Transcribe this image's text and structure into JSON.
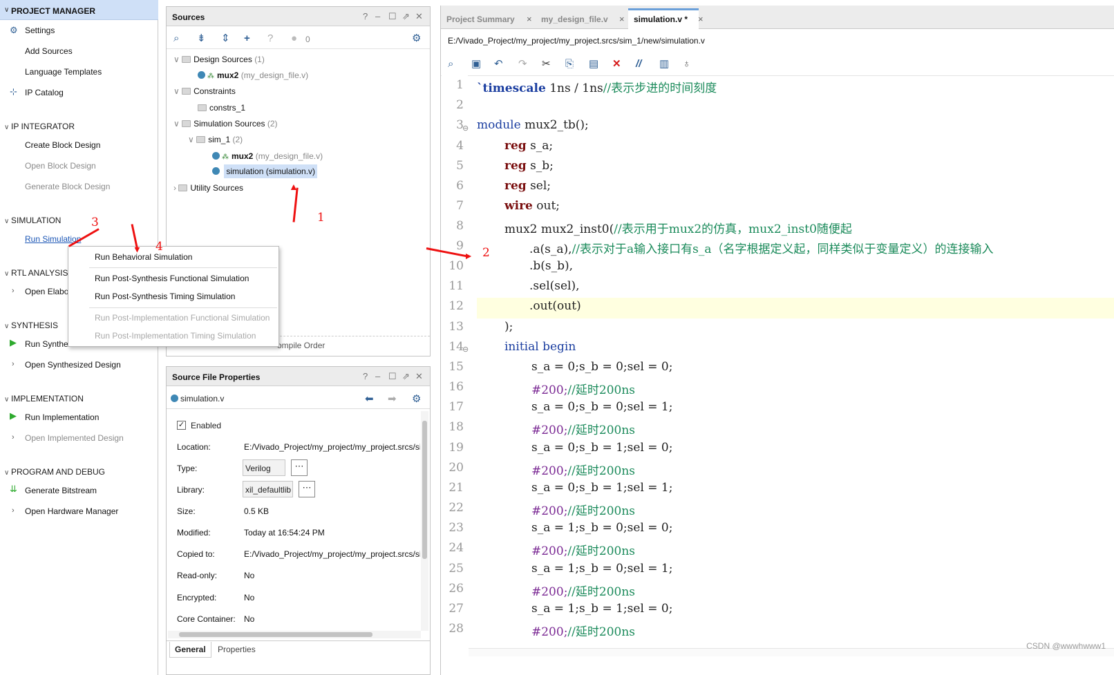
{
  "flow": {
    "project_manager": "PROJECT MANAGER",
    "settings": "Settings",
    "add_sources": "Add Sources",
    "language_templates": "Language Templates",
    "ip_catalog": "IP Catalog",
    "ip_integrator": "IP INTEGRATOR",
    "create_block_design": "Create Block Design",
    "open_block_design": "Open Block Design",
    "generate_block_design": "Generate Block Design",
    "simulation": "SIMULATION",
    "run_simulation": "Run Simulation",
    "rtl_analysis": "RTL ANALYSIS",
    "open_elaborated": "Open Elabo",
    "synthesis": "SYNTHESIS",
    "run_synthesis": "Run Synthe",
    "open_synthesized": "Open Synthesized Design",
    "implementation": "IMPLEMENTATION",
    "run_implementation": "Run Implementation",
    "open_implemented": "Open Implemented Design",
    "program_debug": "PROGRAM AND DEBUG",
    "generate_bitstream": "Generate Bitstream",
    "open_hardware_manager": "Open Hardware Manager"
  },
  "sources": {
    "title": "Sources",
    "badge_count": "0",
    "design_sources": "Design Sources",
    "design_sources_count": "(1)",
    "mux2": "mux2",
    "mux2_file": "(my_design_file.v)",
    "constraints": "Constraints",
    "constrs_1": "constrs_1",
    "simulation_sources": "Simulation Sources",
    "simulation_sources_count": "(2)",
    "sim_1": "sim_1",
    "sim_1_count": "(2)",
    "simulation_item": "simulation (simulation.v)",
    "utility_sources": "Utility Sources",
    "bottom_tab_compile": "ompile Order"
  },
  "menu": {
    "item1": "Run Behavioral Simulation",
    "item2": "Run Post-Synthesis Functional Simulation",
    "item3": "Run Post-Synthesis Timing Simulation",
    "item4": "Run Post-Implementation Functional Simulation",
    "item5": "Run Post-Implementation Timing Simulation"
  },
  "props": {
    "title": "Source File Properties",
    "file": "simulation.v",
    "enabled": "Enabled",
    "location_label": "Location:",
    "location_value": "E:/Vivado_Project/my_project/my_project.srcs/si",
    "type_label": "Type:",
    "type_value": "Verilog",
    "library_label": "Library:",
    "library_value": "xil_defaultlib",
    "size_label": "Size:",
    "size_value": "0.5 KB",
    "modified_label": "Modified:",
    "modified_value": "Today at 16:54:24 PM",
    "copied_label": "Copied to:",
    "copied_value": "E:/Vivado_Project/my_project/my_project.srcs/si",
    "readonly_label": "Read-only:",
    "readonly_value": "No",
    "encrypted_label": "Encrypted:",
    "encrypted_value": "No",
    "core_label": "Core Container:",
    "core_value": "No",
    "tab_general": "General",
    "tab_properties": "Properties"
  },
  "editor": {
    "tab1": "Project Summary",
    "tab2": "my_design_file.v",
    "tab3": "simulation.v *",
    "path": "E:/Vivado_Project/my_project/my_project.srcs/sim_1/new/simulation.v",
    "line_numbers": [
      "1",
      "2",
      "3",
      "4",
      "5",
      "6",
      "7",
      "8",
      "9",
      "10",
      "11",
      "12",
      "13",
      "14",
      "15",
      "16",
      "17",
      "18",
      "19",
      "20",
      "21",
      "22",
      "23",
      "24",
      "25",
      "26",
      "27",
      "28"
    ],
    "l1a": "`timescale",
    "l1b": " 1ns / 1ns",
    "l1c": "//表示步进的时间刻度",
    "l3a": "module",
    "l3b": " mux2_tb();",
    "l4a": "reg",
    "l4b": " s_a;",
    "l5a": "reg",
    "l5b": " s_b;",
    "l6a": "reg",
    "l6b": " sel;",
    "l7a": "wire",
    "l7b": " out;",
    "l8a": "mux2 mux2_inst0(",
    "l8b": "//表示用于mux2的仿真，mux2_inst0随便起",
    "l9a": ".a(s_a),",
    "l9b": "//表示对于a输入接口有s_a（名字根据定义起，同样类似于变量定义）的连接输入",
    "l10": ".b(s_b),",
    "l11": ".sel(sel),",
    "l12": ".out(out)",
    "l13": ");",
    "l14a": "initial",
    "l14b": "begin",
    "l15": "s_a = 0;s_b = 0;sel = 0;",
    "delay": "#200;",
    "delay_comment": "//延时200ns",
    "l17": "s_a = 0;s_b = 0;sel = 1;",
    "l19": "s_a = 0;s_b = 1;sel = 0;",
    "l21": "s_a = 0;s_b = 1;sel = 1;",
    "l23": "s_a = 1;s_b = 0;sel = 0;",
    "l25": "s_a = 1;s_b = 0;sel = 1;",
    "l27": "s_a = 1;s_b = 1;sel = 0;"
  },
  "annotations": {
    "a1": "1",
    "a2": "2",
    "a3": "3",
    "a4": "4"
  },
  "watermark": "CSDN @wwwhwww1"
}
